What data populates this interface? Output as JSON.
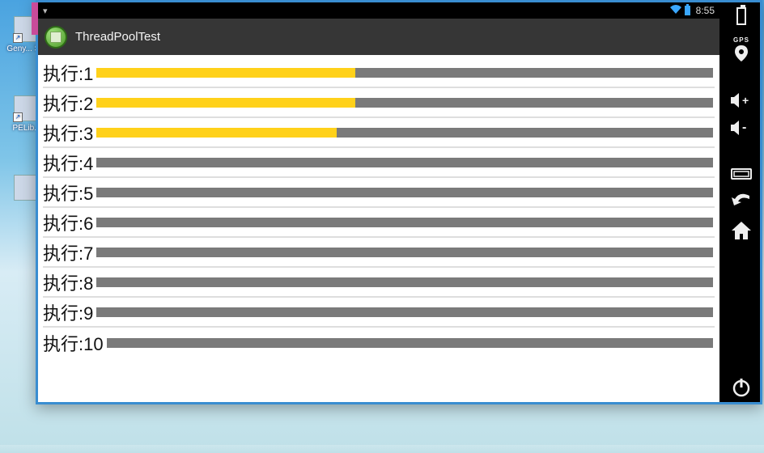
{
  "desktop": {
    "icons": [
      {
        "label": "Geny...\nS..."
      },
      {
        "label": "PELib..."
      },
      {
        "label": ""
      }
    ]
  },
  "statusbar": {
    "signal_glyph": "▾",
    "clock": "8:55"
  },
  "app": {
    "title": "ThreadPoolTest"
  },
  "tasks": [
    {
      "label": "执行:1",
      "progress": 42
    },
    {
      "label": "执行:2",
      "progress": 42
    },
    {
      "label": "执行:3",
      "progress": 39
    },
    {
      "label": "执行:4",
      "progress": 0
    },
    {
      "label": "执行:5",
      "progress": 0
    },
    {
      "label": "执行:6",
      "progress": 0
    },
    {
      "label": "执行:7",
      "progress": 0
    },
    {
      "label": "执行:8",
      "progress": 0
    },
    {
      "label": "执行:9",
      "progress": 0
    },
    {
      "label": "执行:10",
      "progress": 0
    }
  ],
  "sidebar": {
    "gps_label": "GPS"
  },
  "colors": {
    "progress_fill": "#ffd11a",
    "progress_track": "#7a7a7a",
    "actionbar": "#363636",
    "window_border": "#398dd1"
  }
}
